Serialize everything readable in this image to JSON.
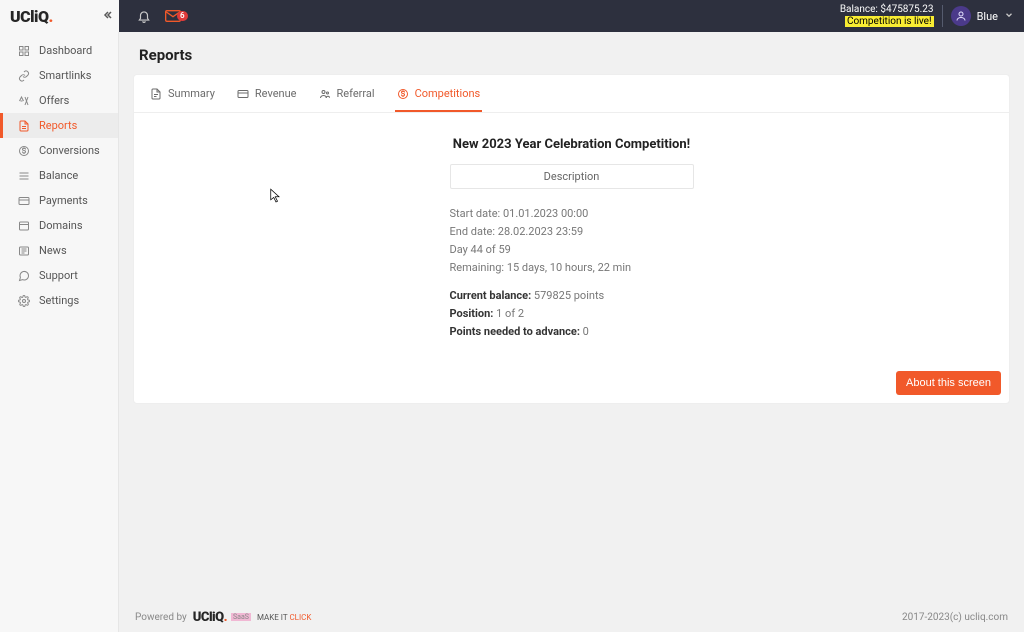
{
  "header": {
    "balance_label": "Balance: $475875.23",
    "live_label": "Competition is live!",
    "mail_badge": "6",
    "user_name": "Blue"
  },
  "sidebar": {
    "items": [
      {
        "label": "Dashboard"
      },
      {
        "label": "Smartlinks"
      },
      {
        "label": "Offers"
      },
      {
        "label": "Reports"
      },
      {
        "label": "Conversions"
      },
      {
        "label": "Balance"
      },
      {
        "label": "Payments"
      },
      {
        "label": "Domains"
      },
      {
        "label": "News"
      },
      {
        "label": "Support"
      },
      {
        "label": "Settings"
      }
    ]
  },
  "page": {
    "title": "Reports"
  },
  "tabs": {
    "summary": "Summary",
    "revenue": "Revenue",
    "referral": "Referral",
    "competitions": "Competitions"
  },
  "competition": {
    "title": "New 2023 Year Celebration Competition!",
    "description_header": "Description",
    "start_date_label": "Start date: ",
    "start_date_value": "01.01.2023 00:00",
    "end_date_label": "End date: ",
    "end_date_value": "28.02.2023 23:59",
    "day_progress": "Day 44 of 59",
    "remaining_label": "Remaining: ",
    "remaining_value": "15 days, 10 hours, 22 min",
    "current_balance_label": "Current balance: ",
    "current_balance_value": "579825 points",
    "position_label": "Position: ",
    "position_value": "1 of 2",
    "points_needed_label": "Points needed to advance: ",
    "points_needed_value": "0"
  },
  "buttons": {
    "about": "About this screen"
  },
  "footer": {
    "powered_by": "Powered by",
    "slogan_prefix": "MAKE IT ",
    "slogan_accent": "CLICK",
    "copyright": "2017-2023(c) ucliq.com"
  }
}
